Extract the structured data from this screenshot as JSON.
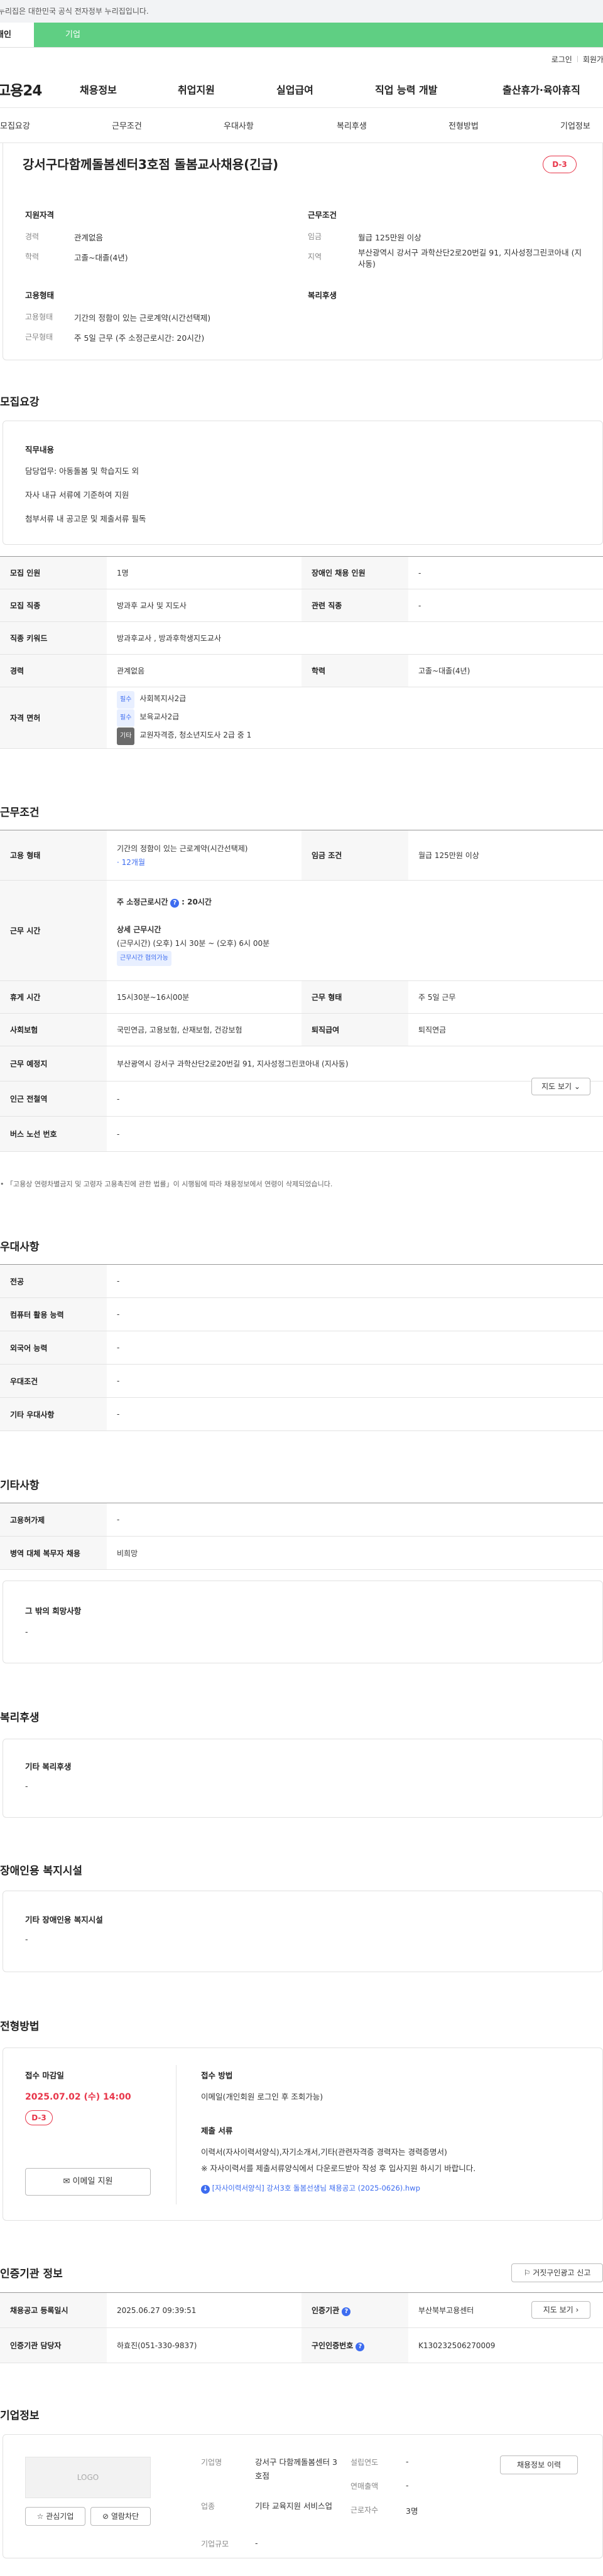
{
  "notice": "이 누리집은 대한민국 공식 전자정부 누리집입니다.",
  "top_tabs": {
    "individual": "개인",
    "corporate": "기업"
  },
  "util": {
    "login": "로그인",
    "join": "회원가입"
  },
  "logo": "고용24",
  "gnb": [
    "채용정보",
    "취업지원",
    "실업급여",
    "직업 능력 개발",
    "출산휴가·육아휴직"
  ],
  "anchor_nav": [
    "모집요강",
    "근무조건",
    "우대사항",
    "복리후생",
    "전형방법",
    "기업정보"
  ],
  "job": {
    "title": "강서구다함께돌봄센터3호점 돌봄교사채용(긴급)",
    "dday": "D-3"
  },
  "summary": {
    "qual_title": "지원자격",
    "career_lbl": "경력",
    "career": "관계없음",
    "edu_lbl": "학력",
    "edu": "고졸~대졸(4년)",
    "cond_title": "근무조건",
    "wage_lbl": "임금",
    "wage": "월급 125만원 이상",
    "region_lbl": "지역",
    "region": "부산광역시 강서구 과학산단2로20번길 91, 지사성정그린코아내 (지사동)",
    "emp_title": "고용형태",
    "emptype_lbl": "고용형태",
    "emptype": "기간의 정함이 있는 근로계약(시간선택제)",
    "worktype_lbl": "근무형태",
    "worktype": "주 5일 근무 (주 소정근로시간: 20시간)",
    "welfare_title": "복리후생"
  },
  "recruit": {
    "section": "모집요강",
    "duty_title": "직무내용",
    "duties": [
      "담당업무: 아동돌봄 및 학습지도 외",
      "자사 내규 서류에 기준하여 지원",
      "첨부서류 내 공고문 및 제출서류 필독"
    ],
    "rows": {
      "count_lbl": "모집 인원",
      "count": "1명",
      "disabled_lbl": "장애인 채용 인원",
      "disabled": "-",
      "job_lbl": "모집 직종",
      "job": "방과후 교사 및 지도사",
      "related_lbl": "관련 직종",
      "related": "-",
      "keyword_lbl": "직종 키워드",
      "keyword": "방과후교사 , 방과후학생지도교사",
      "career_lbl": "경력",
      "career": "관계없음",
      "edu_lbl": "학력",
      "edu": "고졸~대졸(4년)",
      "license_lbl": "자격 면허",
      "licenses": [
        {
          "tag": "필수",
          "name": "사회복지사2급"
        },
        {
          "tag": "필수",
          "name": "보육교사2급"
        },
        {
          "tag": "기타",
          "name": "교원자격증, 청소년지도사 2급 중 1"
        }
      ]
    }
  },
  "work": {
    "section": "근무조건",
    "emp_lbl": "고용 형태",
    "emp": "기간의 정함이 있는 근로계약(시간선택제)",
    "emp_period": "· 12개월",
    "wage_lbl": "임금 조건",
    "wage": "월급 125만원 이상",
    "hours_lbl": "근무 시간",
    "hours_title": "주 소정근로시간",
    "hours_val": ": 20시간",
    "detail_title": "상세 근무시간",
    "detail": "(근무시간) (오후) 1시 30분 ~ (오후) 6시 00분",
    "flex": "근무시간 협의가능",
    "rest_lbl": "휴게 시간",
    "rest": "15시30분~16시00분",
    "form_lbl": "근무 형태",
    "form": "주 5일 근무",
    "insure_lbl": "사회보험",
    "insure": "국민연금, 고용보험, 산재보험, 건강보험",
    "retire_lbl": "퇴직급여",
    "retire": "퇴직연금",
    "place_lbl": "근무 예정지",
    "place": "부산광역시 강서구 과학산단2로20번길 91, 지사성정그린코아내 (지사동)",
    "map_btn": "지도 보기",
    "subway_lbl": "인근 전철역",
    "subway": "-",
    "bus_lbl": "버스 노선 번호",
    "bus": "-",
    "note": "「고용상 연령차별금지 및 고령자 고용촉진에 관한 법률」이 시행됨에 따라 채용정보에서 연령이 삭제되었습니다."
  },
  "pref": {
    "section": "우대사항",
    "rows": [
      {
        "k": "전공",
        "v": "-"
      },
      {
        "k": "컴퓨터 활용 능력",
        "v": "-"
      },
      {
        "k": "외국어 능력",
        "v": "-"
      },
      {
        "k": "우대조건",
        "v": "-"
      },
      {
        "k": "기타 우대사항",
        "v": "-"
      }
    ]
  },
  "etc": {
    "section": "기타사항",
    "rows": [
      {
        "k": "고용허가제",
        "v": "-"
      },
      {
        "k": "병역 대체 복무자 채용",
        "v": "비희망"
      }
    ],
    "other_title": "그 밖의 희망사항",
    "other": "-"
  },
  "welfare": {
    "section": "복리후생",
    "title": "기타 복리후생",
    "val": "-"
  },
  "disab": {
    "section": "장애인용 복지시설",
    "title": "기타 장애인용 복지시설",
    "val": "-"
  },
  "process": {
    "section": "전형방법",
    "deadline_lbl": "접수 마감일",
    "deadline": "2025.07.02 (수) 14:00",
    "dday": "D-3",
    "email_btn": "이메일 지원",
    "method_lbl": "접수 방법",
    "method": "이메일(개인회원 로그인 후 조회가능)",
    "docs_lbl": "제출 서류",
    "docs": "이력서(자사이력서양식),자기소개서,기타(관련자격증 경력자는 경력증명서)",
    "docs2": "※ 자사이력서를 제출서류양식에서 다운로드받아 작성 후 입사지원 하시기 바랍니다.",
    "file": "[자사이력서양식] 강서3호 돌봄선생님 채용공고 (2025-0626).hwp"
  },
  "cert": {
    "section": "인증기관 정보",
    "report_btn": "거짓구인광고 신고",
    "reg_lbl": "채용공고 등록일시",
    "reg": "2025.06.27 09:39:51",
    "org_lbl": "인증기관",
    "org": "부산북부고용센터",
    "map_btn": "지도 보기",
    "mgr_lbl": "인증기관 담당자",
    "mgr": "하효진(051-330-9837)",
    "auth_lbl": "구인인증번호",
    "auth": "K130232506270009"
  },
  "company": {
    "section": "기업정보",
    "logo": "LOGO",
    "fav_btn": "관심기업",
    "block_btn": "열람차단",
    "history_btn": "채용정보 이력",
    "name_lbl": "기업명",
    "name": "강서구 다함께돌봄센터 3호점",
    "found_lbl": "설립연도",
    "found": "-",
    "ind_lbl": "업종",
    "ind": "기타 교육지원 서비스업",
    "sales_lbl": "연매출액",
    "sales": "-",
    "emp_lbl": "근로자수",
    "emp": "3명",
    "scale_lbl": "기업규모",
    "scale": "-"
  }
}
